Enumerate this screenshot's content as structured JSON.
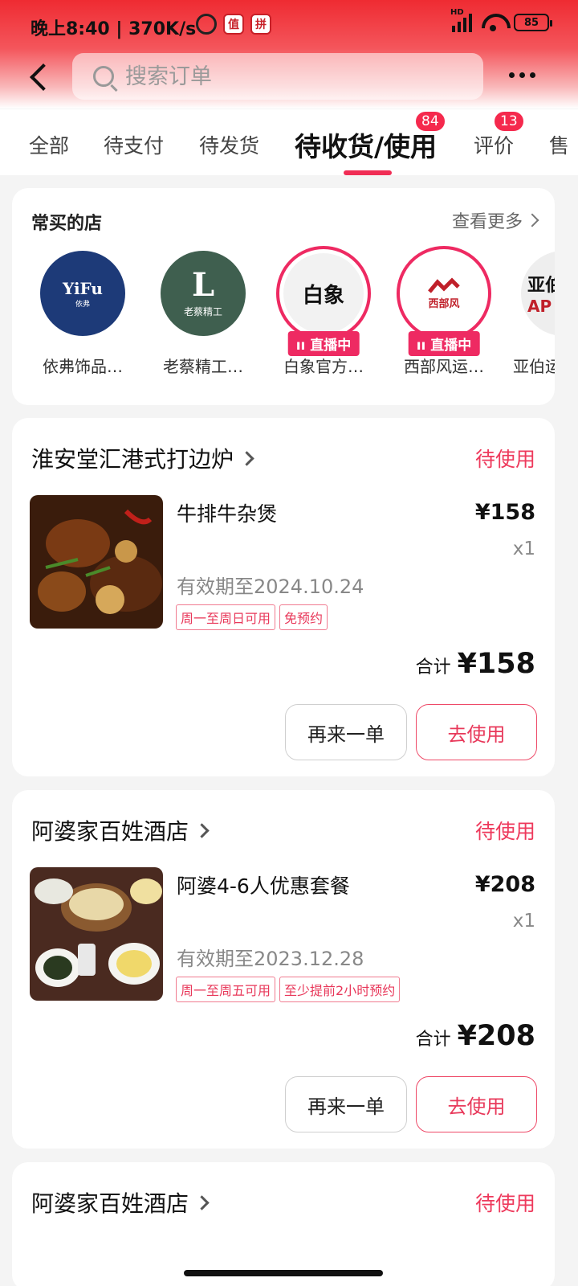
{
  "status_bar": {
    "time": "晚上8:40",
    "speed": "370K/s",
    "battery": "85",
    "network_tag": "HD"
  },
  "search": {
    "placeholder": "搜索订单"
  },
  "tabs": [
    {
      "label": "全部"
    },
    {
      "label": "待支付"
    },
    {
      "label": "待发货"
    },
    {
      "label": "待收货/使用",
      "active": true,
      "badge": "84"
    },
    {
      "label": "评价",
      "badge": "13"
    },
    {
      "label": "售"
    }
  ],
  "frequent_shops": {
    "title": "常买的店",
    "see_more": "查看更多",
    "shops": [
      {
        "name": "依弗饰品…",
        "logo_text": "YiFu",
        "logo_sub": "依弗"
      },
      {
        "name": "老蔡精工…",
        "logo_text": "L",
        "logo_sub": "老蔡精工"
      },
      {
        "name": "白象官方…",
        "logo_text": "白象",
        "live": "直播中"
      },
      {
        "name": "西部风运…",
        "logo_text": "西部风",
        "live": "直播中"
      },
      {
        "name": "亚伯运",
        "logo_text": "亚伯",
        "logo_sub": "AP"
      }
    ]
  },
  "orders": [
    {
      "shop": "淮安堂汇港式打边炉",
      "status": "待使用",
      "item": "牛排牛杂煲",
      "price": "¥158",
      "qty": "x1",
      "validity": "有效期至2024.10.24",
      "tags": [
        "周一至周日可用",
        "免预约"
      ],
      "total_label": "合计",
      "total": "¥158",
      "again": "再来一单",
      "use": "去使用"
    },
    {
      "shop": "阿婆家百姓酒店",
      "status": "待使用",
      "item": "阿婆4-6人优惠套餐",
      "price": "¥208",
      "qty": "x1",
      "validity": "有效期至2023.12.28",
      "tags": [
        "周一至周五可用",
        "至少提前2小时预约"
      ],
      "total_label": "合计",
      "total": "¥208",
      "again": "再来一单",
      "use": "去使用"
    },
    {
      "shop": "阿婆家百姓酒店",
      "status": "待使用"
    }
  ],
  "colors": {
    "accent": "#ee3a5c",
    "badge": "#f5294d",
    "header": "#ef2b32"
  }
}
